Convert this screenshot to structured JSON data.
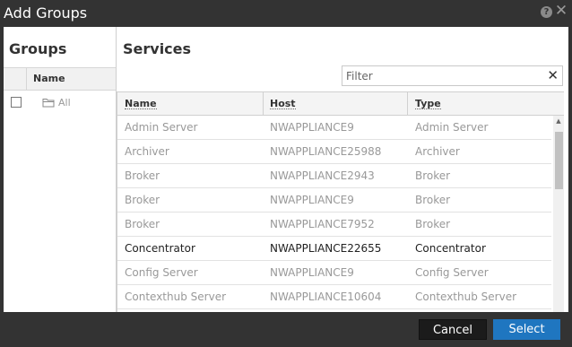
{
  "dialog": {
    "title": "Add Groups"
  },
  "groups": {
    "title": "Groups",
    "column_name": "Name",
    "items": [
      {
        "label": "All",
        "checked": false
      }
    ]
  },
  "services": {
    "title": "Services",
    "filter": {
      "placeholder": "Filter",
      "value": ""
    },
    "columns": [
      "Name",
      "Host",
      "Type"
    ],
    "rows": [
      {
        "name": "Admin Server",
        "host": "NWAPPLIANCE9",
        "type": "Admin Server",
        "enabled": false
      },
      {
        "name": "Archiver",
        "host": "NWAPPLIANCE25988",
        "type": "Archiver",
        "enabled": false
      },
      {
        "name": "Broker",
        "host": "NWAPPLIANCE2943",
        "type": "Broker",
        "enabled": false
      },
      {
        "name": "Broker",
        "host": "NWAPPLIANCE9",
        "type": "Broker",
        "enabled": false
      },
      {
        "name": "Broker",
        "host": "NWAPPLIANCE7952",
        "type": "Broker",
        "enabled": false
      },
      {
        "name": "Concentrator",
        "host": "NWAPPLIANCE22655",
        "type": "Concentrator",
        "enabled": true
      },
      {
        "name": "Config Server",
        "host": "NWAPPLIANCE9",
        "type": "Config Server",
        "enabled": false
      },
      {
        "name": "Contexthub Server",
        "host": "NWAPPLIANCE10604",
        "type": "Contexthub Server",
        "enabled": false
      }
    ]
  },
  "footer": {
    "cancel_label": "Cancel",
    "select_label": "Select"
  },
  "icons": {
    "help": "help-icon",
    "close": "close-icon",
    "folder": "folder-icon",
    "clear": "clear-filter-icon"
  },
  "colors": {
    "accent": "#1f76c0",
    "dialog_bg": "#333333",
    "disabled_text": "#999999"
  }
}
